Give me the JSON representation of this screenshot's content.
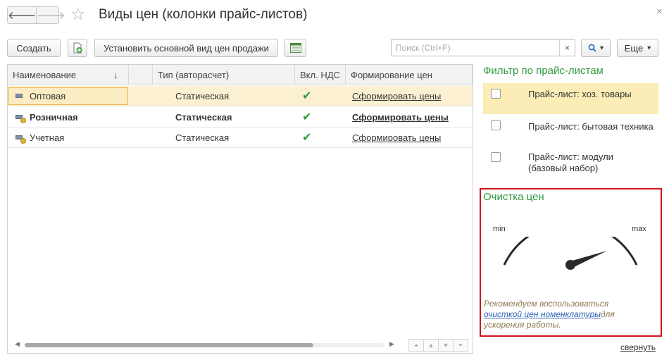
{
  "window": {
    "title": "Виды цен (колонки прайс-листов)",
    "close_symbol": "×",
    "nav": {
      "back_icon": "arrow-left-icon",
      "forward_icon": "arrow-right-icon",
      "back_symbol": "🡐",
      "forward_symbol": "🡒"
    },
    "favorite_symbol": "☆"
  },
  "toolbar": {
    "create_label": "Создать",
    "set_default_label": "Установить основной вид цен продажи",
    "search_placeholder": "Поиск (Ctrl+F)",
    "search_clear": "×",
    "more_label": "Еще",
    "dropdown_symbol": "▾"
  },
  "table": {
    "columns": {
      "name": "Наименование",
      "sort_indicator": "↓",
      "type": "Тип (авторасчет)",
      "vat": "Вкл. НДС",
      "formation": "Формирование цен"
    },
    "rows": [
      {
        "name": "Оптовая",
        "type": "Статическая",
        "vat": "✔",
        "formation": "Сформировать цены",
        "selected": true,
        "bold": false
      },
      {
        "name": "Розничная",
        "type": "Статическая",
        "vat": "✔",
        "formation": "Сформировать цены",
        "selected": false,
        "bold": true
      },
      {
        "name": "Учетная",
        "type": "Статическая",
        "vat": "✔",
        "formation": "Сформировать цены",
        "selected": false,
        "bold": false
      }
    ],
    "pager": [
      "⏶",
      "▲",
      "▼",
      "⏷"
    ],
    "scroll_left": "◀",
    "scroll_right": "▶"
  },
  "filter": {
    "title": "Фильтр по прайс-листам",
    "items": [
      {
        "label": "Прайс-лист: хоз. товары",
        "checked": false
      },
      {
        "label": "Прайс-лист: бытовая техника",
        "checked": false
      },
      {
        "label": "Прайс-лист: модули (базовый набор)",
        "checked": false
      }
    ]
  },
  "price_cleanup": {
    "title": "Очистка цен",
    "gauge_min": "min",
    "gauge_max": "max",
    "hint_prefix": "Рекомендуем воспользоваться",
    "hint_link": "очисткой цен номенклатуры",
    "hint_suffix": "для ускорения работы.",
    "collapse_label": "свернуть"
  },
  "colors": {
    "accent_green": "#2f9b3f",
    "selection_yellow": "#fbf1d2",
    "highlight_red": "#d0141b",
    "link_blue": "#2b5fb4"
  }
}
